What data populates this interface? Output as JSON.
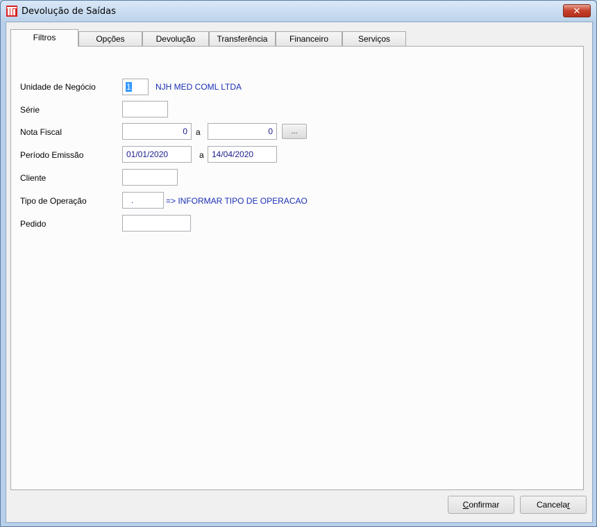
{
  "window": {
    "title": "Devolução de Saídas",
    "close_label": "✕"
  },
  "tabs": [
    {
      "label": "Filtros",
      "active": true
    },
    {
      "label": "Opções",
      "active": false
    },
    {
      "label": "Devolução",
      "active": false
    },
    {
      "label": "Transferência",
      "active": false
    },
    {
      "label": "Financeiro",
      "active": false
    },
    {
      "label": "Serviços",
      "active": false
    }
  ],
  "filters": {
    "unidade_label": "Unidade de Negócio",
    "unidade_value": "1",
    "unidade_name": "NJH MED COML LTDA",
    "serie_label": "Série",
    "serie_value": "",
    "nota_label": "Nota Fiscal",
    "nota_from": "0",
    "nota_sep": "a",
    "nota_to": "0",
    "nota_button": "...",
    "periodo_label": "Período Emissão",
    "periodo_from": "01/01/2020",
    "periodo_sep": "a",
    "periodo_to": "14/04/2020",
    "cliente_label": "Cliente",
    "cliente_value": "",
    "tipo_label": "Tipo de Operação",
    "tipo_value": ".",
    "tipo_info": "=> INFORMAR TIPO DE OPERACAO",
    "pedido_label": "Pedido",
    "pedido_value": ""
  },
  "footer": {
    "confirm_first": "C",
    "confirm_rest": "onfirmar",
    "cancel_main": "Cancela",
    "cancel_last": "r"
  }
}
